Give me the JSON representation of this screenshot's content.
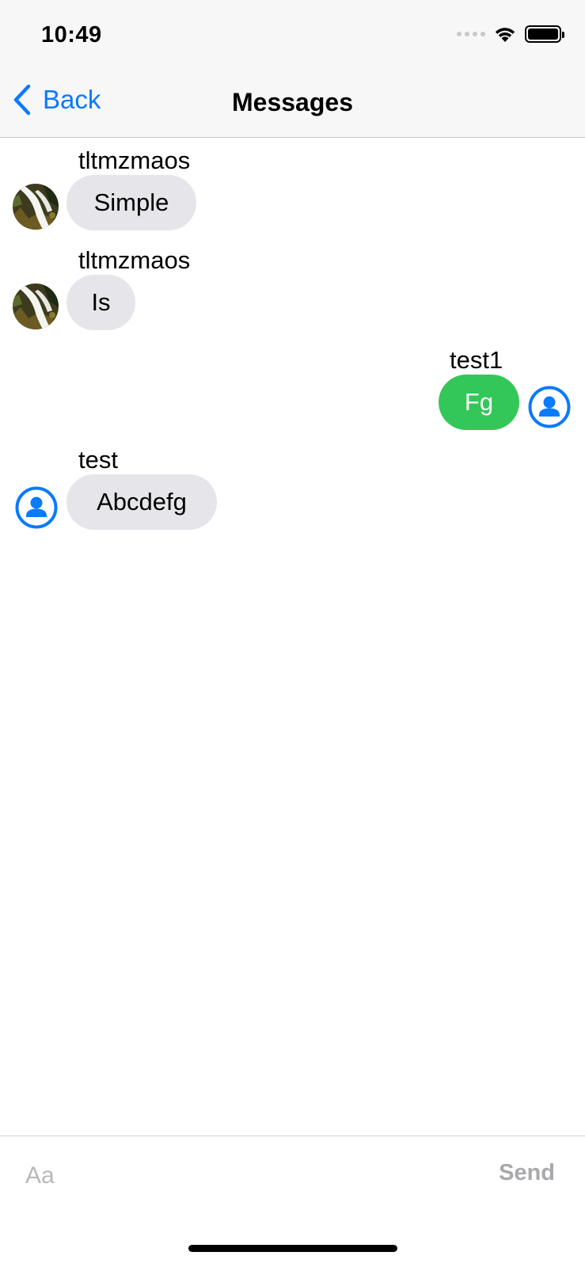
{
  "status_bar": {
    "time": "10:49",
    "icons": [
      "cellular-signal-icon",
      "wifi-icon",
      "battery-icon"
    ]
  },
  "nav": {
    "back_label": "Back",
    "title": "Messages"
  },
  "messages": [
    {
      "sender": "tltmzmaos",
      "text": "Simple",
      "direction": "incoming",
      "avatar": "photo-avatar"
    },
    {
      "sender": "tltmzmaos",
      "text": "Is",
      "direction": "incoming",
      "avatar": "photo-avatar"
    },
    {
      "sender": "test1",
      "text": "Fg",
      "direction": "outgoing",
      "avatar": "person-icon"
    },
    {
      "sender": "test",
      "text": "Abcdefg",
      "direction": "incoming",
      "avatar": "person-icon"
    }
  ],
  "composer": {
    "placeholder": "Aa",
    "send_label": "Send"
  },
  "colors": {
    "accent": "#0a7aff",
    "incoming_bubble": "#e5e5ea",
    "outgoing_bubble": "#33c759",
    "send_disabled": "#a8a8ad"
  }
}
